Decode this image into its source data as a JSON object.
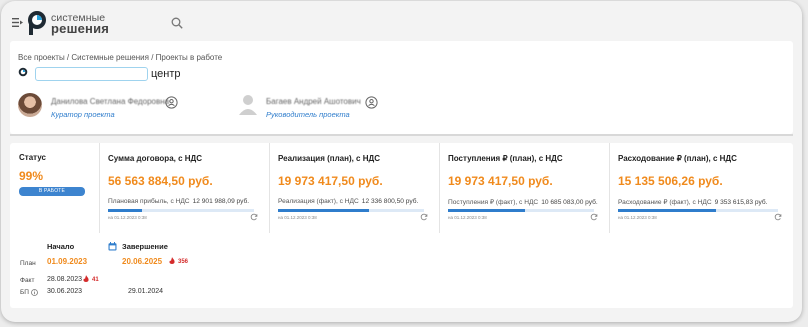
{
  "topbar": {
    "logo_line1": "системные",
    "logo_line2": "решения",
    "icons": {
      "menu": "menu-icon",
      "search": "search-icon"
    }
  },
  "breadcrumb": {
    "items": [
      "Все проекты",
      "Системные решения",
      "Проекты в работе"
    ],
    "separator": " / "
  },
  "project": {
    "title_suffix": "центр"
  },
  "people": [
    {
      "name": "Данилова Светлана Федоровна",
      "role": "Куратор проекта"
    },
    {
      "name": "Багаев Андрей Ашотович",
      "role": "Руководитель проекта"
    }
  ],
  "status": {
    "label": "Статус",
    "percent": "99%",
    "badge": "В РАБОТЕ"
  },
  "metrics": [
    {
      "title": "Сумма договора, с НДС",
      "value": "56 563 884,50 руб.",
      "sub_label": "Плановая прибыль, с НДС",
      "sub_value": "12 901 988,09 руб.",
      "date": "на 01.12.2023 0:38",
      "progress": 0.23
    },
    {
      "title": "Реализация (план), с НДС",
      "value": "19 973 417,50 руб.",
      "sub_label": "Реализация (факт), с НДС",
      "sub_value": "12 336 800,50 руб.",
      "date": "на 01.12.2023 0:38",
      "progress": 0.62
    },
    {
      "title": "Поступления ₽ (план), с НДС",
      "value": "19 973 417,50 руб.",
      "sub_label": "Поступления ₽ (факт), с НДС",
      "sub_value": "10 685 083,00 руб.",
      "date": "на 01.12.2023 0:38",
      "progress": 0.53
    },
    {
      "title": "Расходование ₽ (план), с НДС",
      "value": "15 135 506,26 руб.",
      "sub_label": "Расходование ₽ (факт), с НДС",
      "sub_value": "9 353 615,83 руб.",
      "date": "на 01.12.2023 0:38",
      "progress": 0.61
    }
  ],
  "dates": {
    "start_header": "Начало",
    "end_header": "Завершение",
    "plan_label": "План",
    "fact_label": "Факт",
    "bp_label": "БП",
    "plan_start": "01.09.2023",
    "plan_end": "20.06.2025",
    "plan_end_delay": "356",
    "fact_start": "28.08.2023",
    "fact_start_delay": "41",
    "bp_start": "30.06.2023",
    "bp_end": "29.01.2024"
  },
  "colors": {
    "accent_orange": "#f08a1c",
    "link_blue": "#2f7dcc",
    "badge_blue": "#3d84cf",
    "delay_red": "#d42b2b"
  }
}
